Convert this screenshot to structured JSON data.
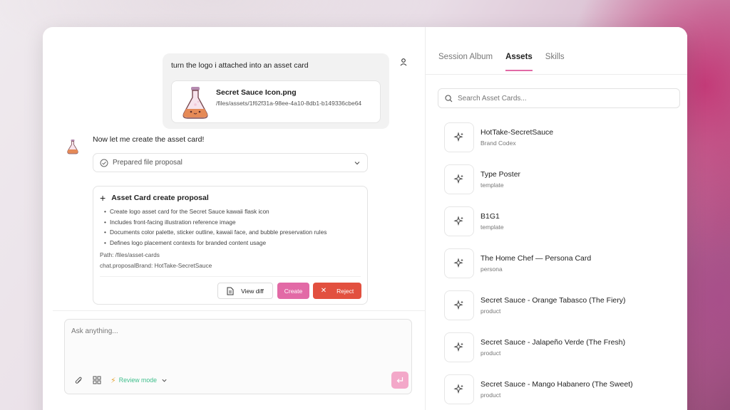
{
  "user_message": {
    "text": "turn the logo i attached into an asset card",
    "attachment": {
      "name": "Secret Sauce Icon.png",
      "path": "/files/assets/1f62f31a-98ee-4a10-8db1-b149336cbe64"
    }
  },
  "assistant": {
    "text": "Now let me create the asset card!",
    "collapsed_label": "Prepared file proposal",
    "proposal": {
      "title": "Asset Card create proposal",
      "bullets": [
        "Create logo asset card for the Secret Sauce kawaii flask icon",
        "Includes front-facing illustration reference image",
        "Documents color palette, sticker outline, kawaii face, and bubble preservation rules",
        "Defines logo placement contexts for branded content usage"
      ],
      "path_line": "Path: /files/asset-cards",
      "brand_line": "chat.proposalBrand: HotTake-SecretSauce",
      "view_diff_label": "View diff",
      "create_label": "Create",
      "reject_label": "Reject"
    }
  },
  "composer": {
    "placeholder": "Ask anything...",
    "mode_label": "Review mode"
  },
  "right_panel": {
    "tabs": [
      {
        "label": "Session Album",
        "active": false
      },
      {
        "label": "Assets",
        "active": true
      },
      {
        "label": "Skills",
        "active": false
      }
    ],
    "search_placeholder": "Search Asset Cards...",
    "assets": [
      {
        "title": "HotTake-SecretSauce",
        "subtitle": "Brand Codex"
      },
      {
        "title": "Type Poster",
        "subtitle": "template"
      },
      {
        "title": "B1G1",
        "subtitle": "template"
      },
      {
        "title": "The Home Chef — Persona Card",
        "subtitle": "persona"
      },
      {
        "title": "Secret Sauce - Orange Tabasco (The Fiery)",
        "subtitle": "product"
      },
      {
        "title": "Secret Sauce - Jalapeño Verde (The Fresh)",
        "subtitle": "product"
      },
      {
        "title": "Secret Sauce - Mango Habanero (The Sweet)",
        "subtitle": "product"
      }
    ]
  },
  "colors": {
    "accent": "#e26aa6",
    "reject": "#e2503f",
    "review_mode": "#3fbf8c",
    "send": "#f3a8c9"
  },
  "icons": [
    "user-icon",
    "flask-icon",
    "check-circle-icon",
    "chevron-down-icon",
    "plus-icon",
    "file-icon",
    "close-icon",
    "paperclip-icon",
    "grid-icon",
    "bolt-icon",
    "enter-icon",
    "search-icon",
    "sparkle-icon"
  ]
}
